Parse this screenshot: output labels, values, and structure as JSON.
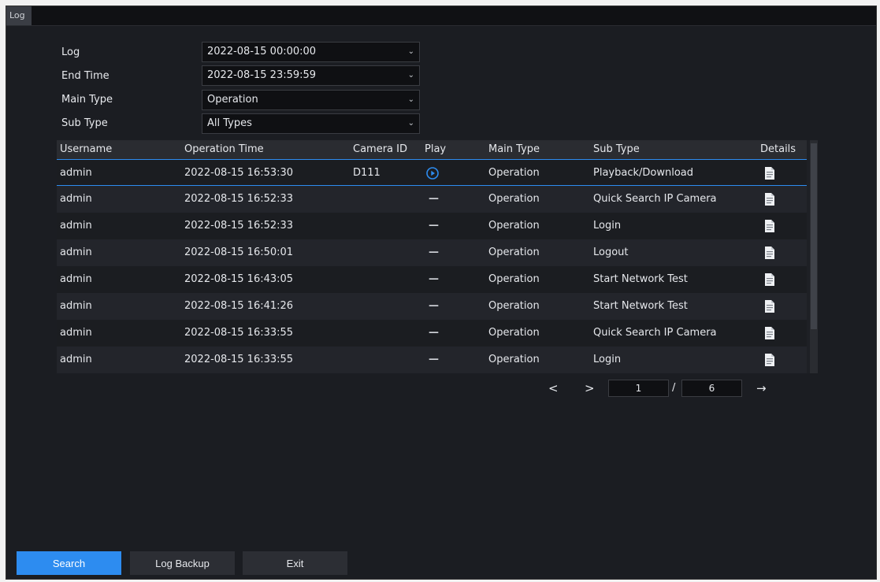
{
  "window": {
    "title": "Log"
  },
  "form": {
    "log_label": "Log",
    "log_value": "2022-08-15 00:00:00",
    "end_time_label": "End Time",
    "end_time_value": "2022-08-15 23:59:59",
    "main_type_label": "Main Type",
    "main_type_value": "Operation",
    "sub_type_label": "Sub Type",
    "sub_type_value": "All Types"
  },
  "table": {
    "headers": {
      "username": "Username",
      "operation_time": "Operation Time",
      "camera_id": "Camera ID",
      "play": "Play",
      "main_type": "Main Type",
      "sub_type": "Sub Type",
      "details": "Details"
    },
    "rows": [
      {
        "username": "admin",
        "time": "2022-08-15 16:53:30",
        "camera": "D111",
        "play": "play-icon",
        "main": "Operation",
        "sub": "Playback/Download"
      },
      {
        "username": "admin",
        "time": "2022-08-15 16:52:33",
        "camera": "",
        "play": "—",
        "main": "Operation",
        "sub": "Quick Search IP Camera"
      },
      {
        "username": "admin",
        "time": "2022-08-15 16:52:33",
        "camera": "",
        "play": "—",
        "main": "Operation",
        "sub": "Login"
      },
      {
        "username": "admin",
        "time": "2022-08-15 16:50:01",
        "camera": "",
        "play": "—",
        "main": "Operation",
        "sub": "Logout"
      },
      {
        "username": "admin",
        "time": "2022-08-15 16:43:05",
        "camera": "",
        "play": "—",
        "main": "Operation",
        "sub": "Start Network Test"
      },
      {
        "username": "admin",
        "time": "2022-08-15 16:41:26",
        "camera": "",
        "play": "—",
        "main": "Operation",
        "sub": "Start Network Test"
      },
      {
        "username": "admin",
        "time": "2022-08-15 16:33:55",
        "camera": "",
        "play": "—",
        "main": "Operation",
        "sub": "Quick Search IP Camera"
      },
      {
        "username": "admin",
        "time": "2022-08-15 16:33:55",
        "camera": "",
        "play": "—",
        "main": "Operation",
        "sub": "Login"
      }
    ]
  },
  "pager": {
    "prev": "<",
    "next": ">",
    "current_page": "1",
    "separator": "/",
    "total_pages": "6",
    "go": "→"
  },
  "buttons": {
    "search": "Search",
    "log_backup": "Log Backup",
    "exit": "Exit"
  },
  "colors": {
    "accent": "#2d8cf0",
    "background": "#1b1d22"
  }
}
